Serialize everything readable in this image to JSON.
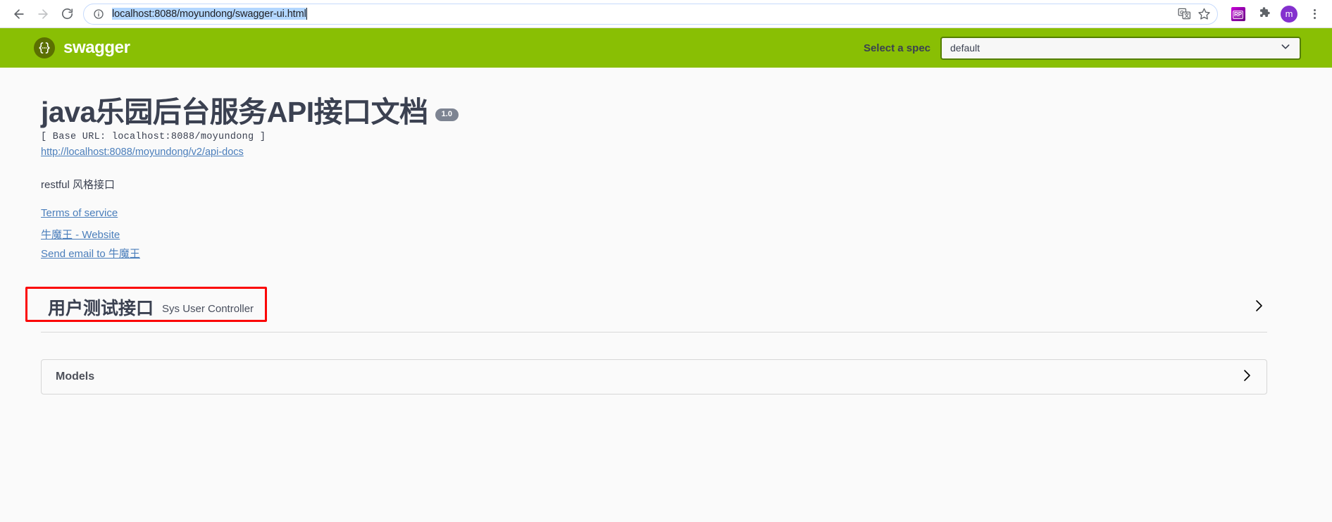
{
  "browser": {
    "back_icon": "back-arrow-icon",
    "forward_icon": "forward-arrow-icon",
    "reload_icon": "reload-icon",
    "site_info_icon": "info-circle-icon",
    "url": "localhost:8088/moyundong/swagger-ui.html",
    "url_selected": true,
    "translate_icon": "translate-icon",
    "bookmark_icon": "star-icon",
    "extension_rp_label": "RP",
    "extensions_icon": "puzzle-piece-icon",
    "avatar_initial": "m",
    "menu_icon": "three-dot-menu-icon"
  },
  "topbar": {
    "logo_glyph": "{···}",
    "logo_text": "swagger",
    "spec_label": "Select a spec",
    "spec_value": "default",
    "spec_options": [
      "default"
    ],
    "chevron_icon": "chevron-down-icon",
    "background_color": "#89bf04"
  },
  "info": {
    "title": "java乐园后台服务API接口文档",
    "version": "1.0",
    "base_url": "[ Base URL: localhost:8088/moyundong ]",
    "api_docs_link": "http://localhost:8088/moyundong/v2/api-docs",
    "description": "restful 风格接口",
    "links": [
      {
        "label": "Terms of service"
      },
      {
        "label": "牛魔王 - Website"
      },
      {
        "label": "Send email to 牛魔王"
      }
    ]
  },
  "tag_section": {
    "title": "用户测试接口",
    "subtitle": "Sys User Controller",
    "expand_icon": "chevron-right-icon",
    "annotation_color": "#fb0505"
  },
  "models_section": {
    "title": "Models",
    "expand_icon": "chevron-right-icon"
  }
}
